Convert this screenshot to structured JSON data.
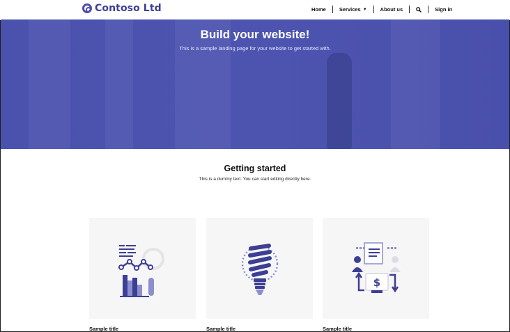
{
  "brand": {
    "name": "Contoso Ltd"
  },
  "nav": {
    "items": [
      {
        "label": "Home"
      },
      {
        "label": "Services",
        "has_dropdown": true
      },
      {
        "label": "About us"
      }
    ],
    "sign_in": "Sign in"
  },
  "hero": {
    "title": "Build your website!",
    "subtitle": "This is a sample landing page for your website to get started with."
  },
  "getting_started": {
    "title": "Getting started",
    "text": "This is a dummy text. You can start editing directly here."
  },
  "cards": [
    {
      "title": "Sample title",
      "icon": "analytics-chart-icon"
    },
    {
      "title": "Sample title",
      "icon": "lightbulb-icon"
    },
    {
      "title": "Sample title",
      "icon": "money-exchange-icon"
    }
  ],
  "colors": {
    "brand": "#3c3f93",
    "hero": "#4a52ae",
    "card_bg": "#f6f6f7",
    "icon_primary": "#3c3f93",
    "icon_secondary": "#8b8fcf"
  }
}
